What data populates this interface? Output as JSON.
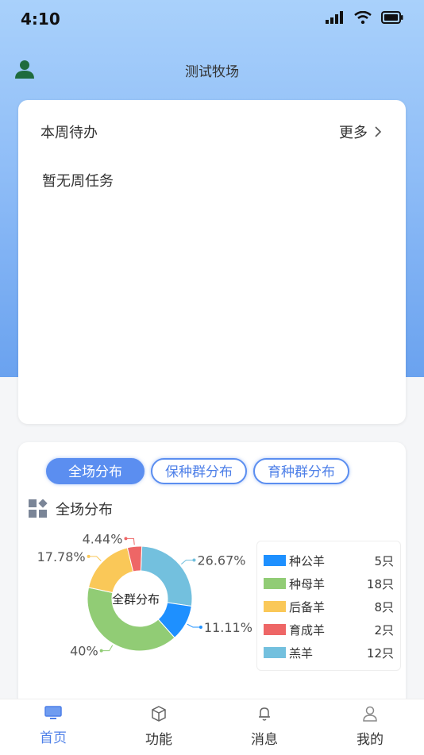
{
  "status_bar": {
    "time": "4:10"
  },
  "header": {
    "title": "测试牧场"
  },
  "todo": {
    "title": "本周待办",
    "more_label": "更多",
    "empty_text": "暂无周任务"
  },
  "distribution": {
    "tabs": [
      {
        "label": "全场分布",
        "active": true
      },
      {
        "label": "保种群分布",
        "active": false
      },
      {
        "label": "育种群分布",
        "active": false
      }
    ],
    "section_title": "全场分布",
    "chart_center_label": "全群分布",
    "legend": [
      {
        "name": "种公羊",
        "count": "5只",
        "color": "#1e90ff"
      },
      {
        "name": "种母羊",
        "count": "18只",
        "color": "#91cc75"
      },
      {
        "name": "后备羊",
        "count": "8只",
        "color": "#fac858"
      },
      {
        "name": "育成羊",
        "count": "2只",
        "color": "#ee6666"
      },
      {
        "name": "羔羊",
        "count": "12只",
        "color": "#73c0de"
      }
    ]
  },
  "chart_data": {
    "type": "pie",
    "categories": [
      "种公羊",
      "种母羊",
      "后备羊",
      "育成羊",
      "羔羊"
    ],
    "values": [
      5,
      18,
      8,
      2,
      12
    ],
    "percent_labels": [
      "11.11%",
      "40%",
      "17.78%",
      "4.44%",
      "26.67%"
    ],
    "colors": [
      "#1e90ff",
      "#91cc75",
      "#fac858",
      "#ee6666",
      "#73c0de"
    ],
    "title": "全群分布",
    "donut": true
  },
  "tabbar": {
    "items": [
      {
        "label": "首页",
        "icon": "monitor-icon",
        "active": true
      },
      {
        "label": "功能",
        "icon": "cube-icon",
        "active": false
      },
      {
        "label": "消息",
        "icon": "bell-icon",
        "active": false
      },
      {
        "label": "我的",
        "icon": "user-icon",
        "active": false
      }
    ]
  }
}
